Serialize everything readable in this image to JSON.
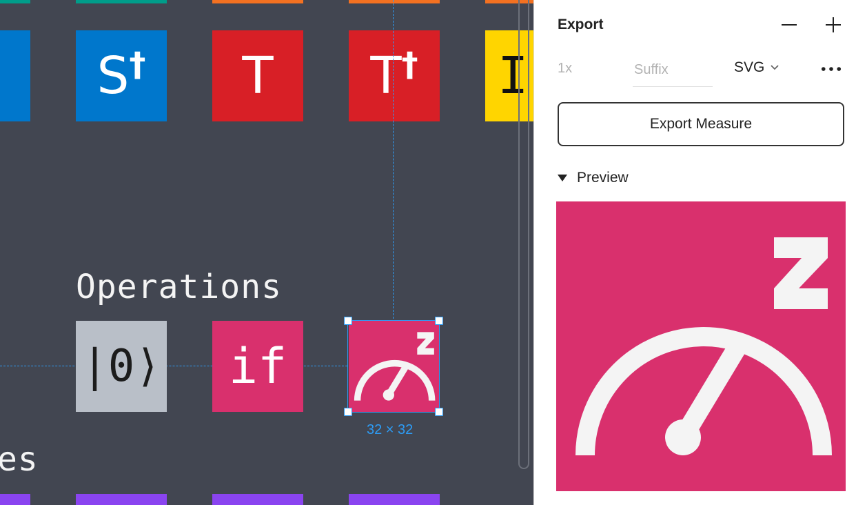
{
  "canvas": {
    "tiles_top": [
      {
        "glyph": "",
        "sup": "",
        "color": "#0077cc"
      },
      {
        "glyph": "S",
        "sup": "†",
        "color": "#0077cc"
      },
      {
        "glyph": "T",
        "sup": "",
        "color": "#d81f26"
      },
      {
        "glyph": "T",
        "sup": "†",
        "color": "#d81f26"
      },
      {
        "glyph": "I",
        "sup": "",
        "color": "#ffd500"
      }
    ],
    "strip_colors_top": [
      "#009d8a",
      "#009d8a",
      "#f37121",
      "#f37121",
      "#f37121"
    ],
    "section_title": "Operations",
    "section_title_partial": "es",
    "tiles_ops": [
      {
        "glyph": "|0⟩",
        "color": "#b9bfc8",
        "text_color": "#1c1c1c"
      },
      {
        "glyph": "if",
        "color": "#d9306d",
        "text_color": "#ffffff"
      },
      {
        "glyph": "",
        "color": "#d9306d",
        "icon": "gauge-sleep-icon"
      }
    ],
    "strip_color_bottom": "#8a44f0",
    "selection_size": "32 × 32",
    "accent": "#2d9cf5"
  },
  "panel": {
    "title": "Export",
    "scale": "1x",
    "suffix_placeholder": "Suffix",
    "format": "SVG",
    "export_button": "Export Measure",
    "preview_label": "Preview",
    "preview_color": "#d9306d"
  }
}
